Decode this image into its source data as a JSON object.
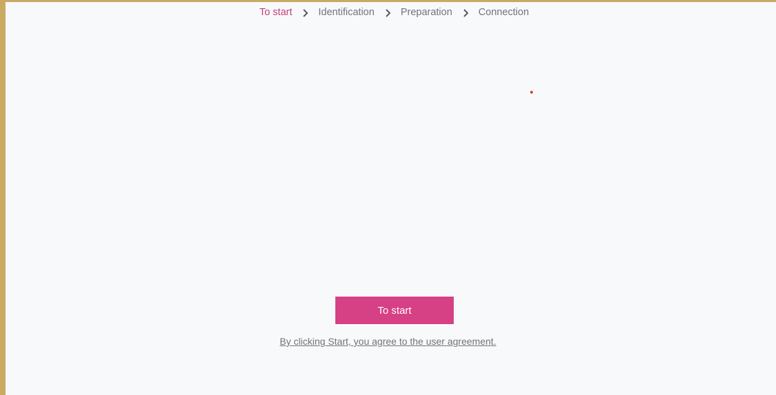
{
  "stepper": {
    "steps": [
      {
        "label": "To start",
        "active": true
      },
      {
        "label": "Identification",
        "active": false
      },
      {
        "label": "Preparation",
        "active": false
      },
      {
        "label": "Connection",
        "active": false
      }
    ],
    "separator_icon": "chevron-right-icon",
    "active_color": "#c0407a"
  },
  "main": {
    "start_button_label": "To start",
    "agreement_link": "By clicking Start, you agree to the user agreement."
  },
  "colors": {
    "accent": "#d64085",
    "background": "#f8f9fb",
    "frame_border": "#c9aa62"
  }
}
